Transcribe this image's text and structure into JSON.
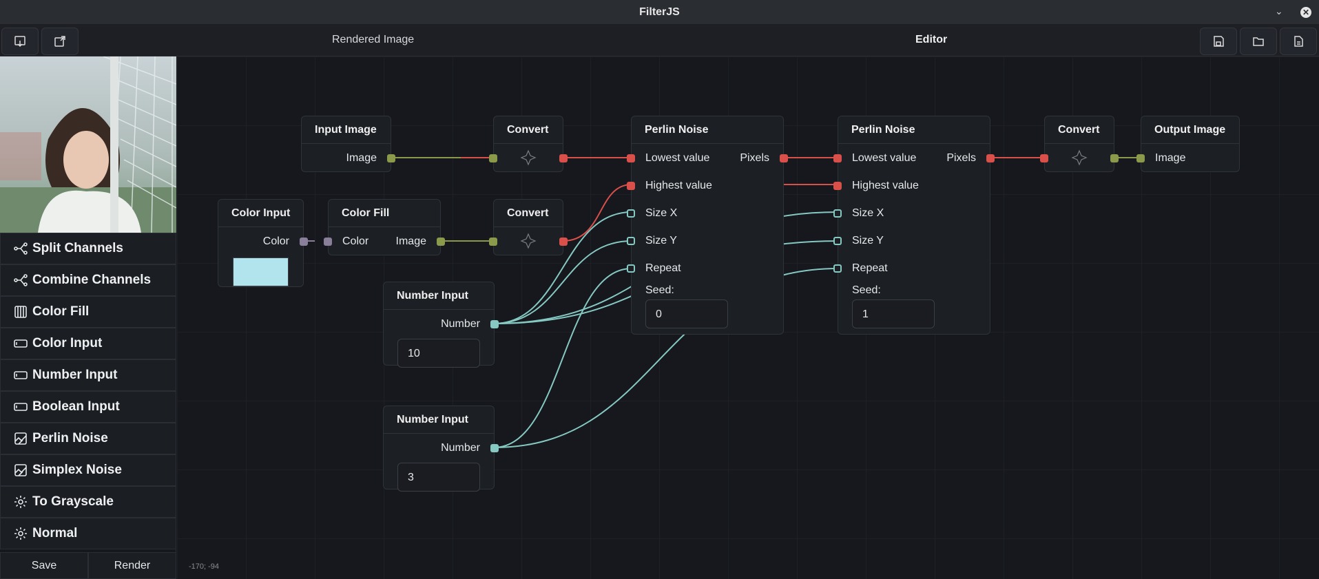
{
  "window": {
    "title": "FilterJS"
  },
  "toolbar": {
    "rendered_label": "Rendered Image",
    "editor_label": "Editor"
  },
  "sidebar": {
    "items": [
      {
        "label": "Split Channels",
        "icon": "split-channels-icon"
      },
      {
        "label": "Combine Channels",
        "icon": "combine-channels-icon"
      },
      {
        "label": "Color Fill",
        "icon": "color-fill-icon"
      },
      {
        "label": "Color Input",
        "icon": "color-input-icon"
      },
      {
        "label": "Number Input",
        "icon": "number-input-icon"
      },
      {
        "label": "Boolean Input",
        "icon": "boolean-input-icon"
      },
      {
        "label": "Perlin Noise",
        "icon": "perlin-noise-icon"
      },
      {
        "label": "Simplex Noise",
        "icon": "simplex-noise-icon"
      },
      {
        "label": "To Grayscale",
        "icon": "gear-icon"
      },
      {
        "label": "Normal",
        "icon": "gear-icon"
      }
    ],
    "save_label": "Save",
    "render_label": "Render"
  },
  "nodes": {
    "input_image": {
      "title": "Input Image",
      "out": "Image"
    },
    "convert1": {
      "title": "Convert"
    },
    "convert2": {
      "title": "Convert"
    },
    "convert3": {
      "title": "Convert"
    },
    "color_input": {
      "title": "Color Input",
      "out": "Color",
      "value": "#b1e4ec"
    },
    "color_fill": {
      "title": "Color Fill",
      "in": "Color",
      "out": "Image"
    },
    "number1": {
      "title": "Number Input",
      "out": "Number",
      "value": "10"
    },
    "number2": {
      "title": "Number Input",
      "out": "Number",
      "value": "3"
    },
    "perlin1": {
      "title": "Perlin Noise",
      "lowest": "Lowest value",
      "highest": "Highest value",
      "sizex": "Size X",
      "sizey": "Size Y",
      "repeat": "Repeat",
      "seed_label": "Seed:",
      "seed": "0",
      "out": "Pixels"
    },
    "perlin2": {
      "title": "Perlin Noise",
      "lowest": "Lowest value",
      "highest": "Highest value",
      "sizex": "Size X",
      "sizey": "Size Y",
      "repeat": "Repeat",
      "seed_label": "Seed:",
      "seed": "1",
      "out": "Pixels"
    },
    "output_image": {
      "title": "Output Image",
      "in": "Image"
    }
  },
  "canvas": {
    "coords": "-170; -94"
  },
  "colors": {
    "red": "#d9504a",
    "olive": "#8a9a4a",
    "teal": "#86c9c3",
    "purple": "#8a7f9a"
  }
}
